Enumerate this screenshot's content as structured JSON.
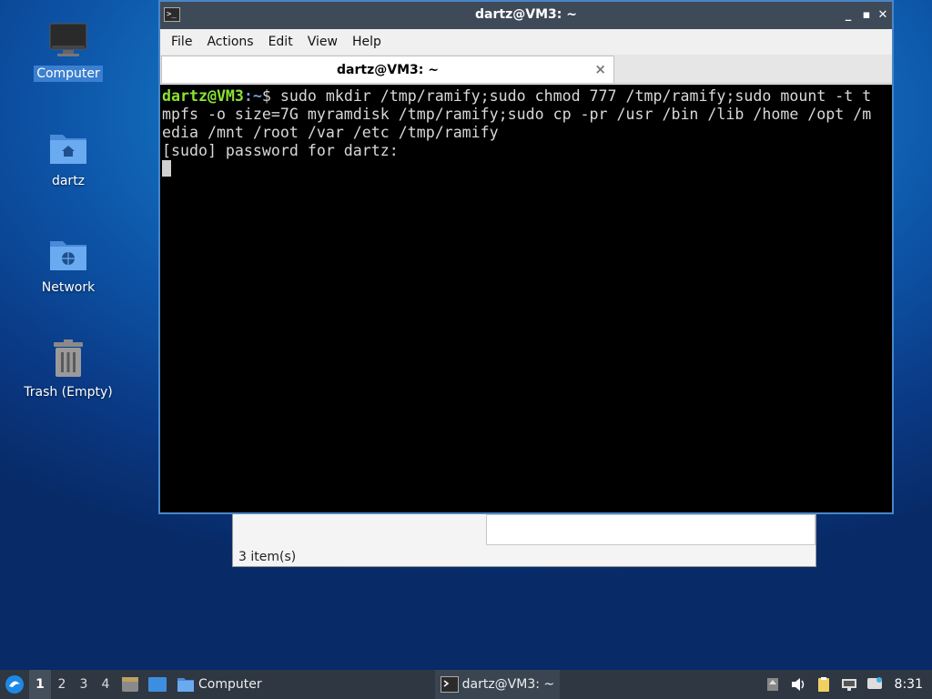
{
  "desktop": {
    "icons": [
      {
        "label": "Computer",
        "icon": "computer-icon"
      },
      {
        "label": "dartz",
        "icon": "home-folder-icon"
      },
      {
        "label": "Network",
        "icon": "network-folder-icon"
      },
      {
        "label": "Trash (Empty)",
        "icon": "trash-icon"
      }
    ]
  },
  "file_manager": {
    "status": "3 item(s)"
  },
  "terminal": {
    "window_title": "dartz@VM3: ~",
    "menu": [
      "File",
      "Actions",
      "Edit",
      "View",
      "Help"
    ],
    "tab_title": "dartz@VM3: ~",
    "tab_close": "×",
    "prompt_user": "dartz@VM3",
    "prompt_path": ":~",
    "prompt_symbol": "$ ",
    "lines": [
      "sudo mkdir /tmp/ramify;sudo chmod 777 /tmp/ramify;sudo mount -t t",
      "mpfs -o size=7G myramdisk /tmp/ramify;sudo cp -pr /usr /bin /lib /home /opt /m",
      "edia /mnt /root /var /etc /tmp/ramify",
      "[sudo] password for dartz: "
    ]
  },
  "window_buttons": {
    "minimize": "_",
    "maximize": "▪",
    "close": "✕"
  },
  "taskbar": {
    "workspaces": [
      "1",
      "2",
      "3",
      "4"
    ],
    "active_workspace": "1",
    "tasks": [
      {
        "label": "Computer",
        "icon": "folder-icon"
      },
      {
        "label": "dartz@VM3: ~",
        "icon": "terminal-icon"
      }
    ],
    "clock": "8:31"
  },
  "colors": {
    "prompt_user": "#8ae234",
    "prompt_path": "#729fcf",
    "terminal_bg": "#000000",
    "titlebar": "#3f4a58",
    "window_border": "#4a86c8",
    "taskbar": "#2f3742"
  }
}
